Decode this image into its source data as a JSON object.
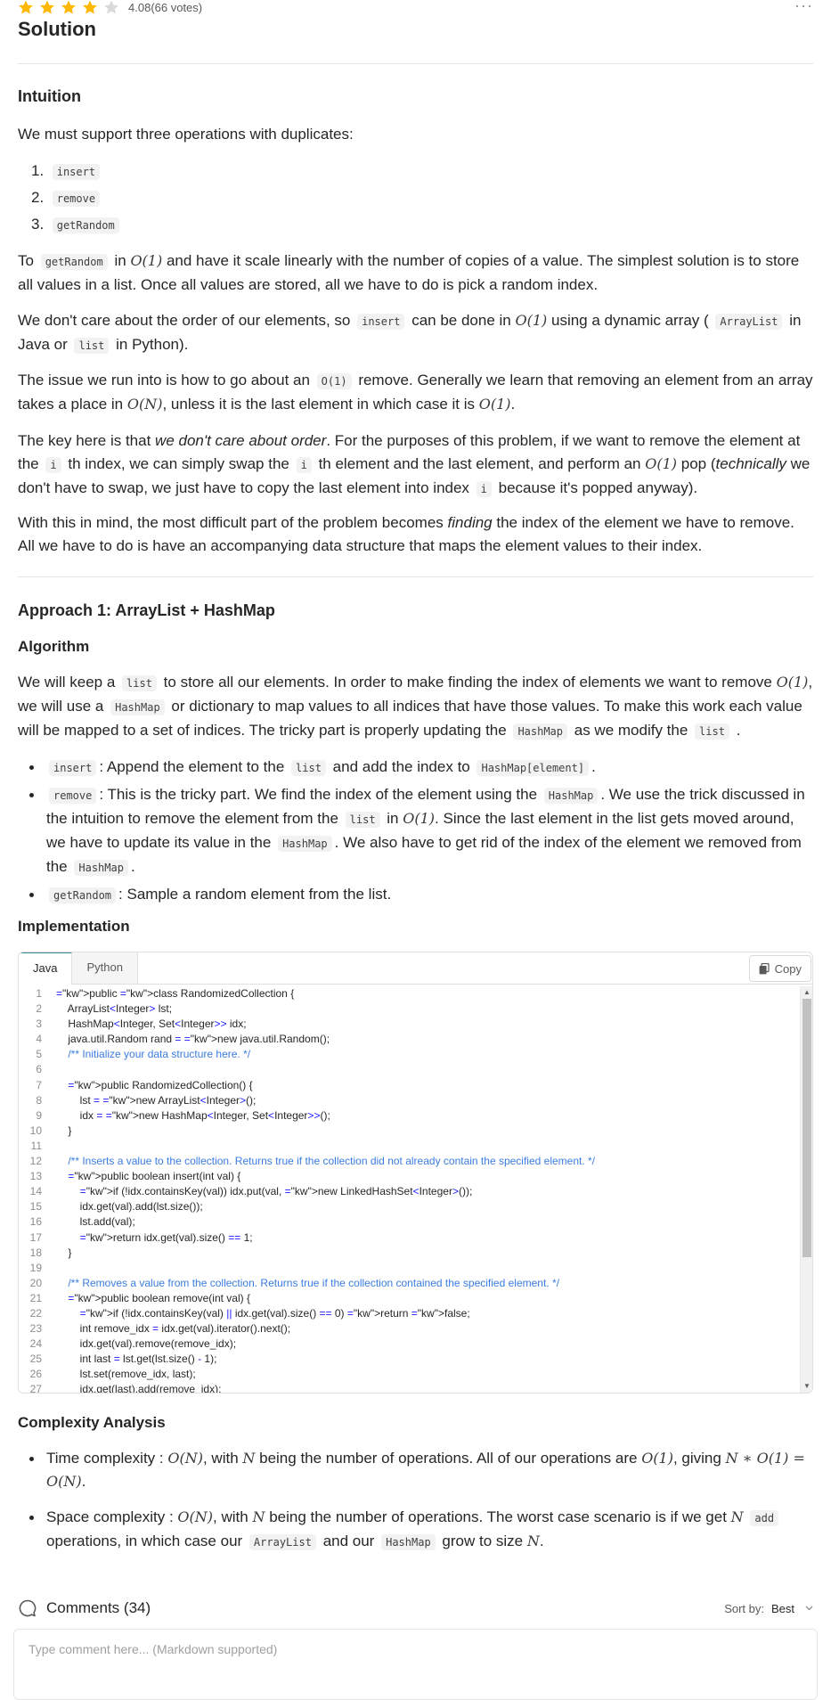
{
  "rating": {
    "score": "4.08",
    "votes": "(66 votes)",
    "stars_filled": 4,
    "stars_total": 5,
    "star_color": "#ffb800",
    "star_empty_color": "#d9d9d9"
  },
  "more_icon": "···",
  "solution_title": "Solution",
  "intuition": {
    "heading": "Intuition",
    "intro": "We must support three operations with duplicates:",
    "ops": [
      {
        "num": "1.",
        "code": "insert"
      },
      {
        "num": "2.",
        "code": "remove"
      },
      {
        "num": "3.",
        "code": "getRandom"
      }
    ],
    "p1": {
      "a": "To",
      "code1": "getRandom",
      "b": "in",
      "math1": "O(1)",
      "c": "and have it scale linearly with the number of copies of a value. The simplest solution is to store all values in a list. Once all values are stored, all we have to do is pick a random index."
    },
    "p2": {
      "a": "We don't care about the order of our elements, so",
      "code1": "insert",
      "b": "can be done in",
      "math1": "O(1)",
      "c": "using a dynamic array (",
      "code2": "ArrayList",
      "d": "in Java or",
      "code3": "list",
      "e": "in Python)."
    },
    "p3": {
      "a": "The issue we run into is how to go about an",
      "code1": "O(1)",
      "b": "remove. Generally we learn that removing an element from an array takes a place in",
      "math1": "O(N)",
      "c": ", unless it is the last element in which case it is",
      "math2": "O(1)",
      "d": "."
    },
    "p4": {
      "a": "The key here is that",
      "em1": "we don't care about order",
      "b": ". For the purposes of this problem, if we want to remove the element at the",
      "code1": "i",
      "c": "th index, we can simply swap the",
      "code2": "i",
      "d": "th element and the last element, and perform an",
      "math1": "O(1)",
      "e": "pop (",
      "em2": "technically",
      "f": "we don't have to swap, we just have to copy the last element into index",
      "code3": "i",
      "g": "because it's popped anyway)."
    },
    "p5": {
      "a": "With this in mind, the most difficult part of the problem becomes",
      "em1": "finding",
      "b": "the index of the element we have to remove. All we have to do is have an accompanying data structure that maps the element values to their index."
    }
  },
  "approach": {
    "heading": "Approach 1: ArrayList + HashMap",
    "algorithm_heading": "Algorithm",
    "p1": {
      "a": "We will keep a",
      "code1": "list",
      "b": "to store all our elements. In order to make finding the index of elements we want to remove",
      "math1": "O(1)",
      "c": ", we will use a",
      "code2": "HashMap",
      "d": "or dictionary to map values to all indices that have those values. To make this work each value will be mapped to a set of indices. The tricky part is properly updating the",
      "code3": "HashMap",
      "e": "as we modify the",
      "code4": "list",
      "f": "."
    },
    "bullets": {
      "b1": {
        "code1": "insert",
        "a": ": Append the element to the",
        "code2": "list",
        "b": "and add the index to",
        "code3": "HashMap[element]",
        "c": "."
      },
      "b2": {
        "code1": "remove",
        "a": ": This is the tricky part. We find the index of the element using the",
        "code2": "HashMap",
        "b": ". We use the trick discussed in the intuition to remove the element from the",
        "code3": "list",
        "c": "in",
        "math1": "O(1)",
        "d": ". Since the last element in the list gets moved around, we have to update its value in the",
        "code4": "HashMap",
        "e": ". We also have to get rid of the index of the element we removed from the",
        "code5": "HashMap",
        "f": "."
      },
      "b3": {
        "code1": "getRandom",
        "a": ": Sample a random element from the list."
      }
    },
    "implementation_heading": "Implementation"
  },
  "code_panel": {
    "tabs": [
      "Java",
      "Python"
    ],
    "copy_label": "Copy",
    "lines": [
      {
        "n": "1",
        "t": "public class RandomizedCollection {"
      },
      {
        "n": "2",
        "t": "    ArrayList<Integer> lst;"
      },
      {
        "n": "3",
        "t": "    HashMap<Integer, Set<Integer>> idx;"
      },
      {
        "n": "4",
        "t": "    java.util.Random rand = new java.util.Random();"
      },
      {
        "n": "5",
        "t": "    /** Initialize your data structure here. */"
      },
      {
        "n": "6",
        "t": ""
      },
      {
        "n": "7",
        "t": "    public RandomizedCollection() {"
      },
      {
        "n": "8",
        "t": "        lst = new ArrayList<Integer>();"
      },
      {
        "n": "9",
        "t": "        idx = new HashMap<Integer, Set<Integer>>();"
      },
      {
        "n": "10",
        "t": "    }"
      },
      {
        "n": "11",
        "t": ""
      },
      {
        "n": "12",
        "t": "    /** Inserts a value to the collection. Returns true if the collection did not already contain the specified element. */"
      },
      {
        "n": "13",
        "t": "    public boolean insert(int val) {"
      },
      {
        "n": "14",
        "t": "        if (!idx.containsKey(val)) idx.put(val, new LinkedHashSet<Integer>());"
      },
      {
        "n": "15",
        "t": "        idx.get(val).add(lst.size());"
      },
      {
        "n": "16",
        "t": "        lst.add(val);"
      },
      {
        "n": "17",
        "t": "        return idx.get(val).size() == 1;"
      },
      {
        "n": "18",
        "t": "    }"
      },
      {
        "n": "19",
        "t": ""
      },
      {
        "n": "20",
        "t": "    /** Removes a value from the collection. Returns true if the collection contained the specified element. */"
      },
      {
        "n": "21",
        "t": "    public boolean remove(int val) {"
      },
      {
        "n": "22",
        "t": "        if (!idx.containsKey(val) || idx.get(val).size() == 0) return false;"
      },
      {
        "n": "23",
        "t": "        int remove_idx = idx.get(val).iterator().next();"
      },
      {
        "n": "24",
        "t": "        idx.get(val).remove(remove_idx);"
      },
      {
        "n": "25",
        "t": "        int last = lst.get(lst.size() - 1);"
      },
      {
        "n": "26",
        "t": "        lst.set(remove_idx, last);"
      },
      {
        "n": "27",
        "t": "        idx.get(last).add(remove_idx);"
      }
    ]
  },
  "complexity": {
    "heading": "Complexity Analysis",
    "time": {
      "a": "Time complexity :",
      "math1": "O(N)",
      "b": ", with",
      "math2": "N",
      "c": "being the number of operations. All of our operations are",
      "math3": "O(1)",
      "d": ", giving",
      "math4": "N ∗ O(1) =",
      "math5": "O(N)",
      "e": "."
    },
    "space": {
      "a": "Space complexity :",
      "math1": "O(N)",
      "b": ", with",
      "math2": "N",
      "c": "being the number of operations. The worst case scenario is if we get",
      "math3": "N",
      "code1": "add",
      "d": "operations, in which case our",
      "code2": "ArrayList",
      "e": "and our",
      "code3": "HashMap",
      "f": "grow to size",
      "math4": "N",
      "g": "."
    }
  },
  "comments": {
    "title": "Comments (34)",
    "sort_label": "Sort by:",
    "sort_value": "Best",
    "placeholder": "Type comment here... (Markdown supported)"
  }
}
